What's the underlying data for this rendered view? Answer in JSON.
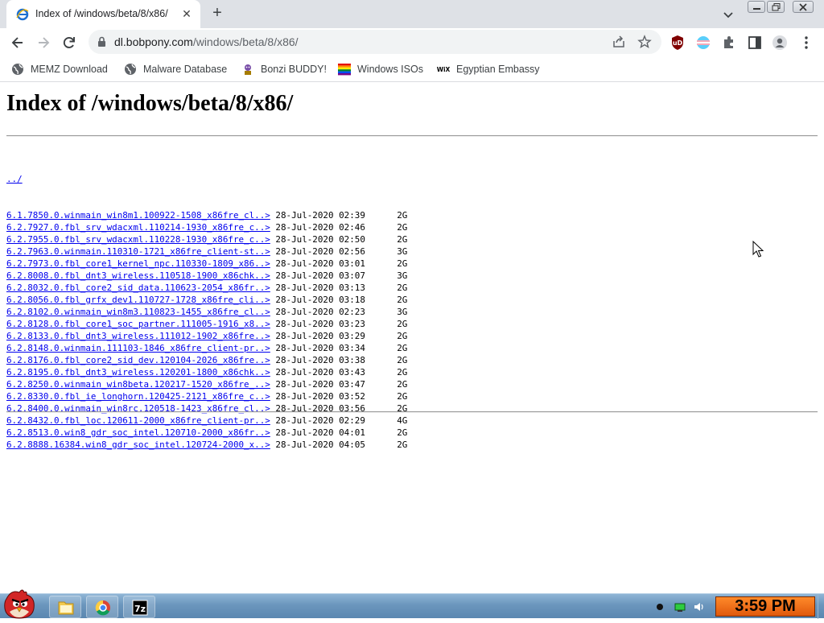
{
  "browser": {
    "tab": {
      "title": "Index of /windows/beta/8/x86/",
      "close_glyph": "✕"
    },
    "new_tab_glyph": "+",
    "url": {
      "host": "dl.bobpony.com",
      "path": "/windows/beta/8/x86/"
    },
    "accent_color": "#dee1e6"
  },
  "bookmarks": [
    {
      "label": "MEMZ Download",
      "icon": "globe-icon"
    },
    {
      "label": "Malware Database",
      "icon": "globe-icon"
    },
    {
      "label": "Bonzi BUDDY!",
      "icon": "bonzi-icon"
    },
    {
      "label": "Windows ISOs",
      "icon": "rainbow-flag-icon"
    },
    {
      "label": "Egyptian Embassy",
      "icon": "wix-icon"
    }
  ],
  "page": {
    "heading": "Index of /windows/beta/8/x86/",
    "parent_link": "../",
    "entries": [
      {
        "name": "6.1.7850.0.winmain_win8m1.100922-1508_x86fre_cl..>",
        "date": "28-Jul-2020 02:39",
        "size": "2G"
      },
      {
        "name": "6.2.7927.0.fbl_srv_wdacxml.110214-1930_x86fre_c..>",
        "date": "28-Jul-2020 02:46",
        "size": "2G"
      },
      {
        "name": "6.2.7955.0.fbl_srv_wdacxml.110228-1930_x86fre_c..>",
        "date": "28-Jul-2020 02:50",
        "size": "2G"
      },
      {
        "name": "6.2.7963.0.winmain.110310-1721_x86fre_client-st..>",
        "date": "28-Jul-2020 02:56",
        "size": "3G"
      },
      {
        "name": "6.2.7973.0.fbl_core1_kernel_npc.110330-1809_x86..>",
        "date": "28-Jul-2020 03:01",
        "size": "2G"
      },
      {
        "name": "6.2.8008.0.fbl_dnt3_wireless.110518-1900_x86chk..>",
        "date": "28-Jul-2020 03:07",
        "size": "3G"
      },
      {
        "name": "6.2.8032.0.fbl_core2_sid_data.110623-2054_x86fr..>",
        "date": "28-Jul-2020 03:13",
        "size": "2G"
      },
      {
        "name": "6.2.8056.0.fbl_grfx_dev1.110727-1728_x86fre_cli..>",
        "date": "28-Jul-2020 03:18",
        "size": "2G"
      },
      {
        "name": "6.2.8102.0.winmain_win8m3.110823-1455_x86fre_cl..>",
        "date": "28-Jul-2020 02:23",
        "size": "3G"
      },
      {
        "name": "6.2.8128.0.fbl_core1_soc_partner.111005-1916_x8..>",
        "date": "28-Jul-2020 03:23",
        "size": "2G"
      },
      {
        "name": "6.2.8133.0.fbl_dnt3_wireless.111012-1902_x86fre..>",
        "date": "28-Jul-2020 03:29",
        "size": "2G"
      },
      {
        "name": "6.2.8148.0.winmain.111103-1846_x86fre_client-pr..>",
        "date": "28-Jul-2020 03:34",
        "size": "2G"
      },
      {
        "name": "6.2.8176.0.fbl_core2_sid_dev.120104-2026_x86fre..>",
        "date": "28-Jul-2020 03:38",
        "size": "2G"
      },
      {
        "name": "6.2.8195.0.fbl_dnt3_wireless.120201-1800_x86chk..>",
        "date": "28-Jul-2020 03:43",
        "size": "2G"
      },
      {
        "name": "6.2.8250.0.winmain_win8beta.120217-1520_x86fre_..>",
        "date": "28-Jul-2020 03:47",
        "size": "2G"
      },
      {
        "name": "6.2.8330.0.fbl_ie_longhorn.120425-2121_x86fre_c..>",
        "date": "28-Jul-2020 03:52",
        "size": "2G"
      },
      {
        "name": "6.2.8400.0.winmain_win8rc.120518-1423_x86fre_cl..>",
        "date": "28-Jul-2020 03:56",
        "size": "2G"
      },
      {
        "name": "6.2.8432.0.fbl_loc.120611-2000_x86fre_client-pr..>",
        "date": "28-Jul-2020 02:29",
        "size": "4G"
      },
      {
        "name": "6.2.8513.0.win8_gdr_soc_intel.120710-2000_x86fr..>",
        "date": "28-Jul-2020 04:01",
        "size": "2G"
      },
      {
        "name": "6.2.8888.16384.win8_gdr_soc_intel.120724-2000_x..>",
        "date": "28-Jul-2020 04:05",
        "size": "2G"
      }
    ]
  },
  "taskbar": {
    "apps": [
      {
        "name": "file-explorer",
        "icon": "folder-icon"
      },
      {
        "name": "chrome",
        "icon": "chrome-icon"
      },
      {
        "name": "7-zip",
        "icon": "7zip-icon",
        "label": "7z"
      }
    ],
    "clock": "3:59 PM"
  }
}
